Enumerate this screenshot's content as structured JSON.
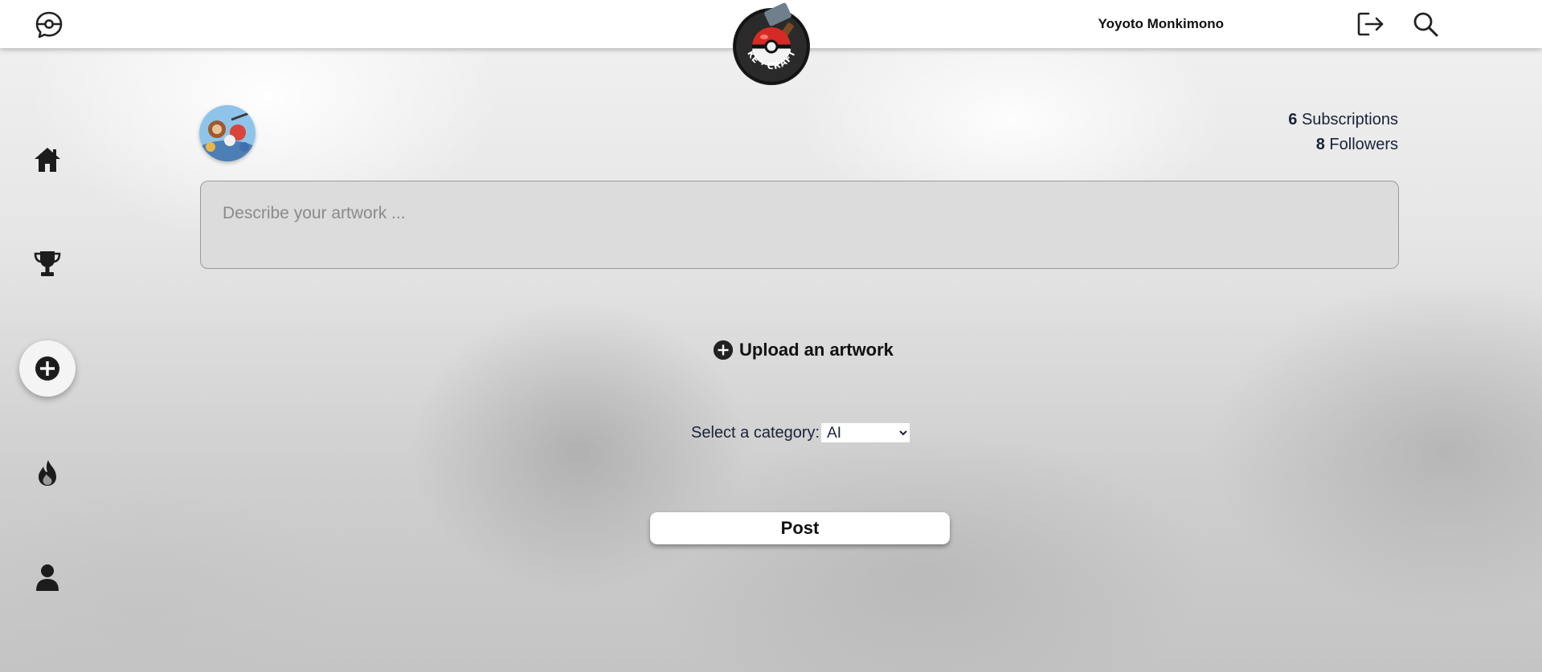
{
  "header": {
    "username": "Yoyoto Monkimono",
    "logo_text": "POKE · CRAFTER",
    "icons": [
      "pokeball-chat-icon",
      "logout-icon",
      "search-icon"
    ]
  },
  "sidebar": {
    "items": [
      {
        "icon": "home-icon",
        "active": false
      },
      {
        "icon": "trophy-icon",
        "active": false
      },
      {
        "icon": "plus-circle-icon",
        "active": true
      },
      {
        "icon": "flame-icon",
        "active": false
      },
      {
        "icon": "user-icon",
        "active": false
      }
    ]
  },
  "profile": {
    "subscriptions_count": "6",
    "subscriptions_label": "Subscriptions",
    "followers_count": "8",
    "followers_label": "Followers"
  },
  "form": {
    "description_placeholder": "Describe your artwork ...",
    "description_value": "",
    "upload_label": "Upload an artwork",
    "category_label": "Select a category:",
    "category_selected": "AI",
    "post_label": "Post"
  },
  "colors": {
    "text_dark": "#1a2238",
    "input_bg": "#dcdcdc",
    "logo_red": "#d62b24"
  }
}
